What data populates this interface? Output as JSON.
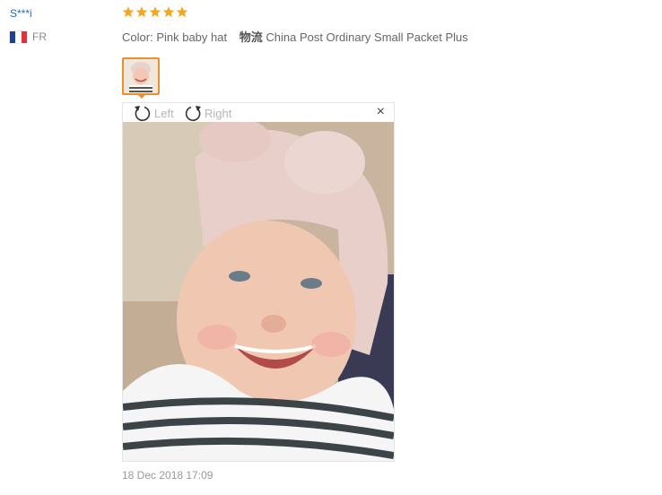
{
  "review": {
    "user": "S***i",
    "country": "FR",
    "rating": 5,
    "color_label": "Color:",
    "color_value": "Pink baby hat",
    "logistics_label": "物流",
    "logistics_value": "China Post Ordinary Small Packet Plus",
    "date": "18 Dec 2018 17:09"
  },
  "viewer": {
    "rotate_left_label": "Left",
    "rotate_right_label": "Right",
    "close_label": "×"
  },
  "colors": {
    "star": "#f5a623",
    "thumb_border": "#e88f2f",
    "username": "#2a6aa8"
  },
  "icons": [
    "star-icon",
    "fr-flag-icon",
    "rotate-left-icon",
    "rotate-right-icon",
    "close-icon"
  ]
}
